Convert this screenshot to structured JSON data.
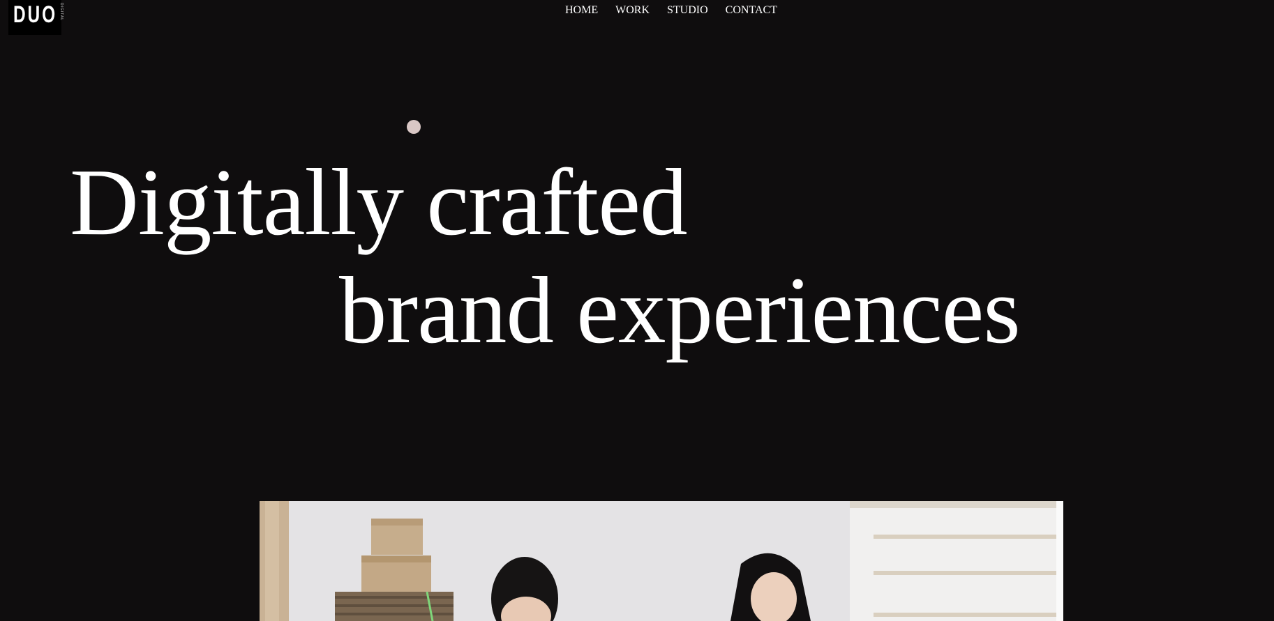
{
  "logo": {
    "mark": "DUO",
    "sub": "DIGITAL"
  },
  "nav": {
    "items": [
      {
        "label": "HOME",
        "active": true
      },
      {
        "label": "WORK",
        "active": false
      },
      {
        "label": "STUDIO",
        "active": false
      },
      {
        "label": "CONTACT",
        "active": false
      }
    ]
  },
  "hero": {
    "line1": "Digitally crafted",
    "line2": "brand experiences"
  },
  "colors": {
    "background": "#0f0d0e",
    "text": "#ffffff",
    "cursor_dot": "#d9c7c5"
  },
  "media": {
    "subject": "photo-of-two-people-with-cardboard-boxes"
  }
}
